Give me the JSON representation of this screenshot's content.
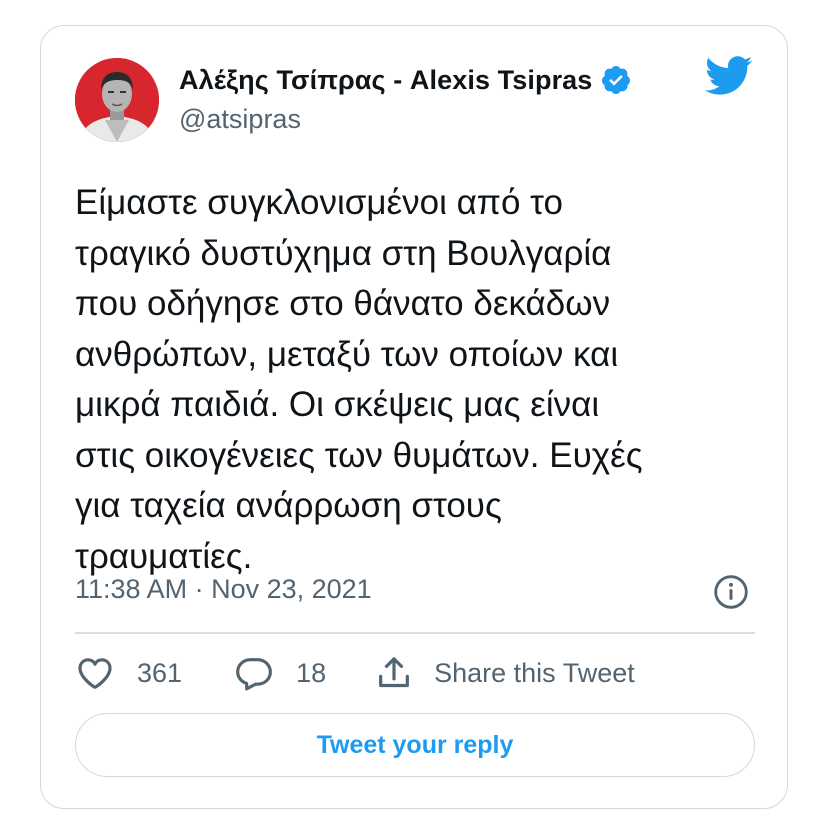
{
  "author": {
    "display_name": "Αλέξης Τσίπρας - Alexis Tsipras",
    "handle": "@atsipras",
    "verified": true,
    "avatar_icon": "profile-photo",
    "avatar_color": "#d8262f"
  },
  "brand": {
    "icon": "twitter-bird-icon",
    "color": "#1d9bf0"
  },
  "tweet": {
    "lines": [
      "Είμαστε συγκλονισμένοι από το",
      "τραγικό δυστύχημα στη Βουλγαρία",
      "που οδήγησε στο θάνατο δεκάδων",
      "ανθρώπων, μεταξύ των οποίων και",
      "μικρά παιδιά. Οι σκέψεις μας είναι",
      "στις οικογένειες των θυμάτων. Ευχές",
      "για ταχεία ανάρρωση στους",
      "τραυματίες."
    ],
    "timestamp": "11:38 AM · Nov 23, 2021"
  },
  "actions": {
    "likes": "361",
    "replies": "18",
    "share_label": "Share this Tweet"
  },
  "reply_button": {
    "label": "Tweet your reply"
  }
}
